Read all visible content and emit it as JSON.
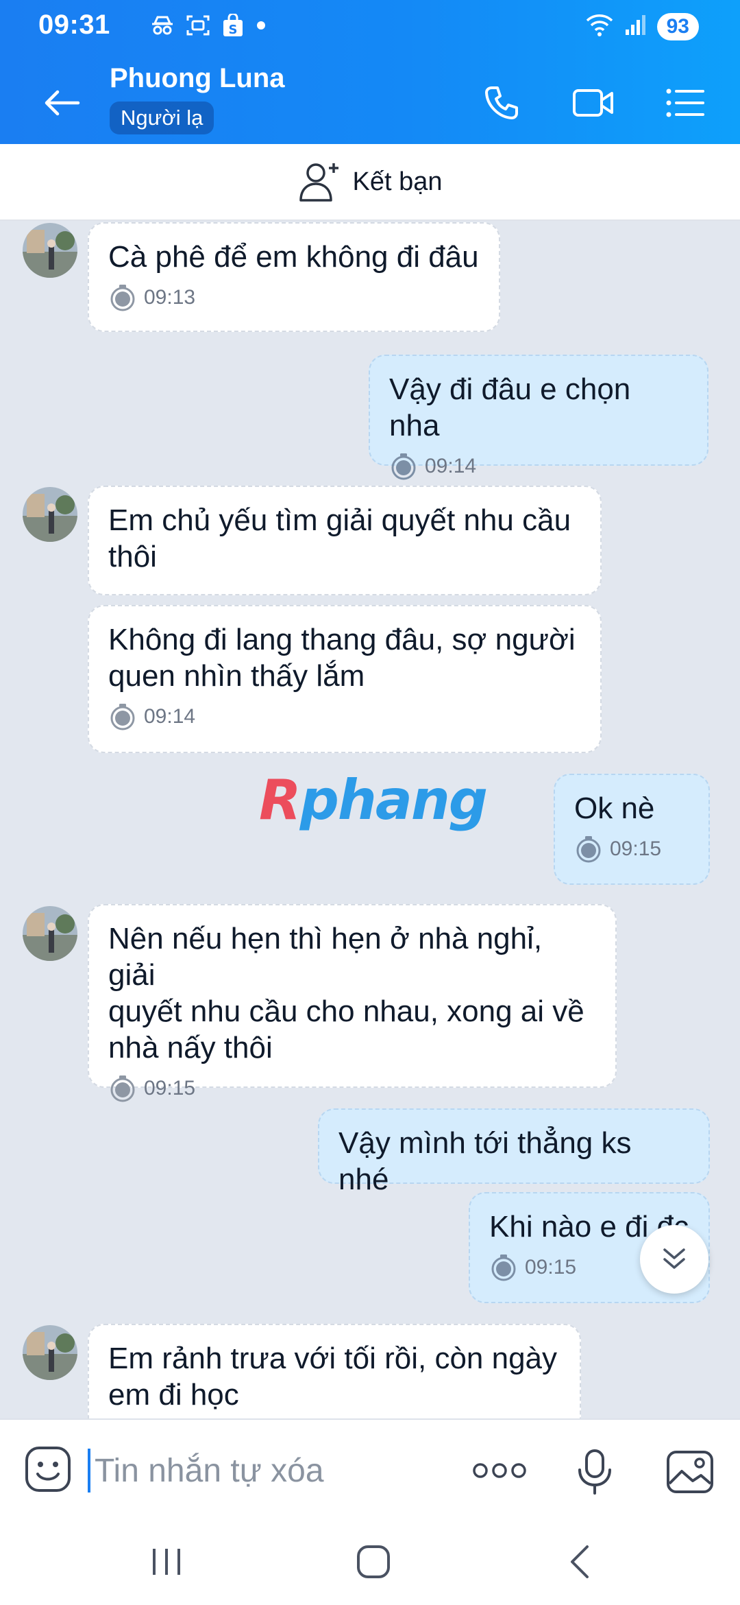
{
  "status_bar": {
    "time": "09:31",
    "battery": "93",
    "icons": [
      "incognito-icon",
      "screenshot-icon",
      "shopping-bag-icon",
      "dot-icon",
      "wifi-icon",
      "signal-icon"
    ]
  },
  "header": {
    "contact_name": "Phuong Luna",
    "badge": "Người lạ",
    "buttons": [
      "back-arrow-icon",
      "phone-icon",
      "video-call-icon",
      "menu-list-icon"
    ],
    "gradient_colors": [
      "#1a7ef2",
      "#0ea0fb"
    ]
  },
  "friend_bar": {
    "label": "Kết bạn",
    "icon": "add-friend-icon"
  },
  "messages": [
    {
      "side": "in",
      "text": "Cà phê để em không đi đâu",
      "time": "09:13"
    },
    {
      "side": "out",
      "text": "Vậy đi đâu e chọn nha",
      "time": "09:14"
    },
    {
      "side": "in",
      "text": "Em chủ yếu tìm giải quyết nhu cầu\nthôi",
      "time": ""
    },
    {
      "side": "in",
      "text": "Không đi lang thang đâu, sợ người\nquen nhìn thấy lắm",
      "time": "09:14"
    },
    {
      "side": "out",
      "text": "Ok nè",
      "time": "09:15"
    },
    {
      "side": "in",
      "text": "Nên nếu hẹn thì hẹn ở nhà nghỉ, giải\nquyết nhu cầu cho nhau, xong ai về\nnhà nấy thôi",
      "time": "09:15"
    },
    {
      "side": "out",
      "text": "Vậy mình tới thẳng ks nhé",
      "time": ""
    },
    {
      "side": "out",
      "text": "Khi nào e đi đc",
      "time": "09:15"
    },
    {
      "side": "in",
      "text": "Em rảnh trưa với tối rồi, còn ngày\nem đi học",
      "time": ""
    }
  ],
  "watermark": {
    "part1": "R",
    "part2": "phang"
  },
  "input_bar": {
    "placeholder": "Tin nhắn tự xóa",
    "value": "",
    "icons": [
      "emoji-sticker-icon",
      "more-options-icon",
      "microphone-icon",
      "image-gallery-icon"
    ]
  },
  "nav_bar": {
    "buttons": [
      "recent-apps-icon",
      "home-icon",
      "back-icon"
    ]
  },
  "colors": {
    "chat_background": "#e2e7ef",
    "incoming_bubble": "#ffffff",
    "outgoing_bubble": "#d5ecfd",
    "accent": "#1a7ef2"
  }
}
